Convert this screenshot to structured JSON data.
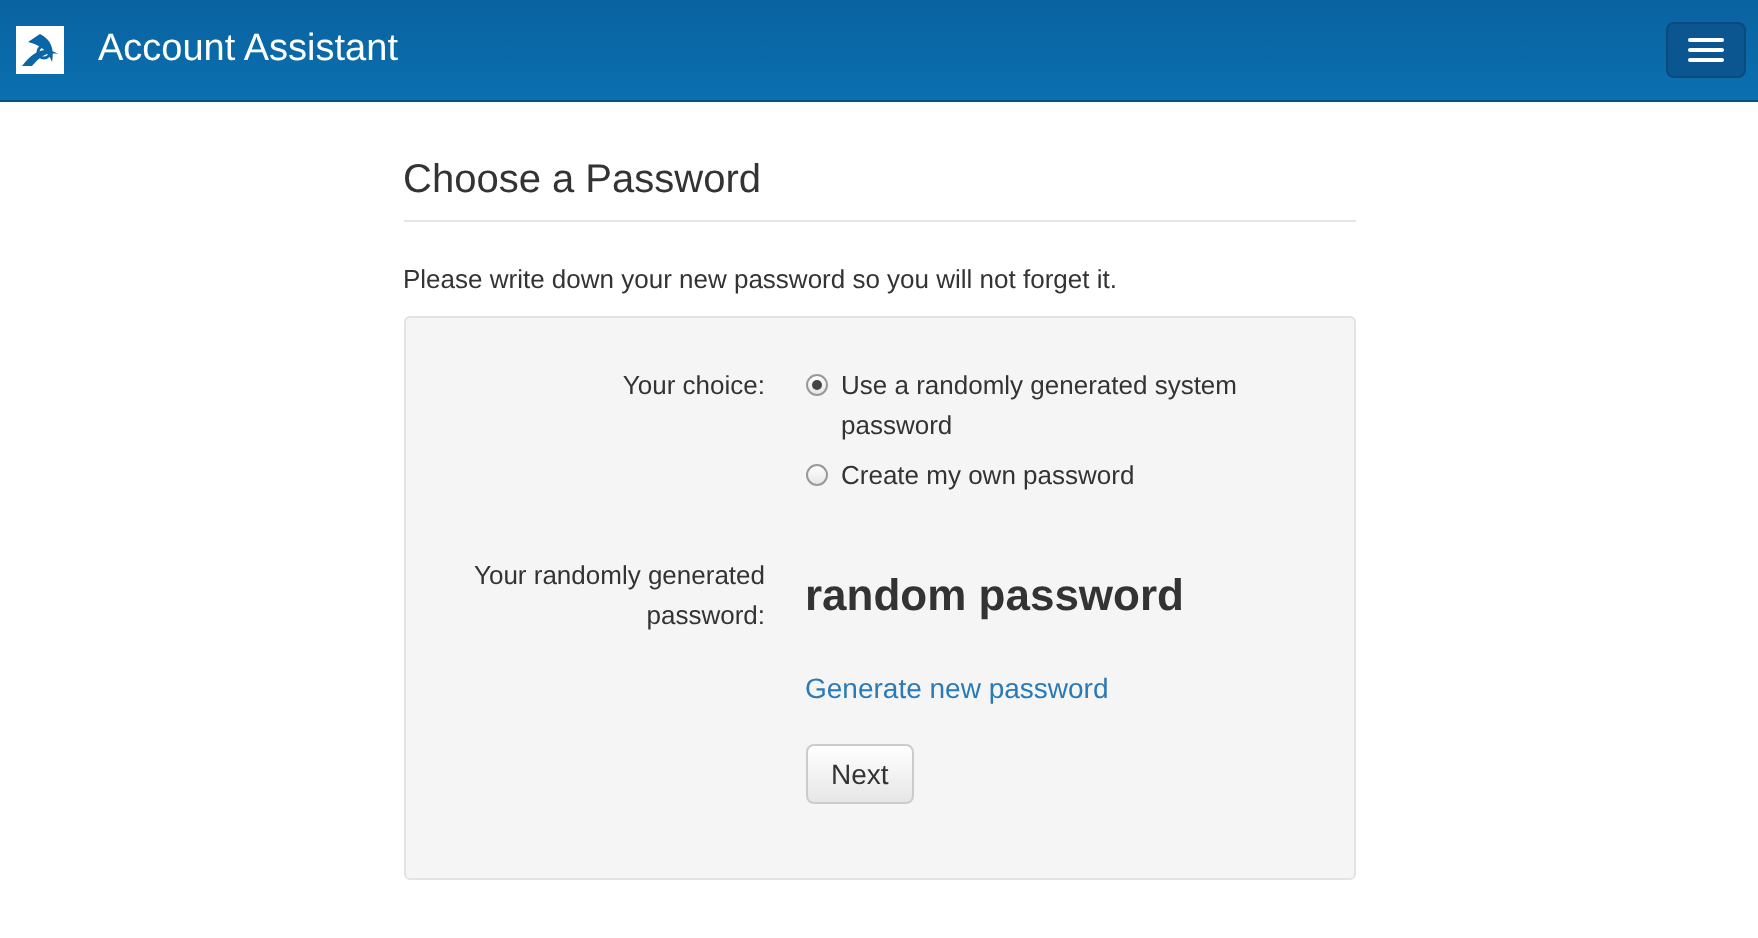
{
  "header": {
    "title": "Account Assistant"
  },
  "page": {
    "title": "Choose a Password",
    "intro": "Please write down your new password so you will not forget it."
  },
  "form": {
    "choice_label": "Your choice:",
    "options": [
      {
        "label": "Use a randomly generated system password",
        "selected": true
      },
      {
        "label": "Create my own password",
        "selected": false
      }
    ],
    "password_label": "Your randomly generated password:",
    "password": "random password",
    "generate_link": "Generate new password",
    "next_button": "Next"
  }
}
